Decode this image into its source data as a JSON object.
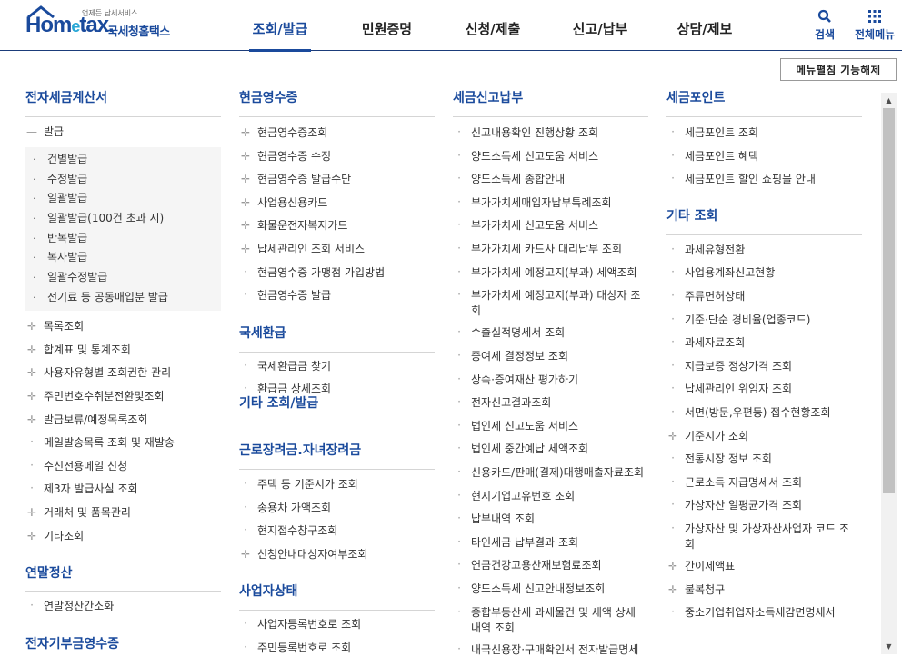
{
  "header": {
    "logo_small": "언제든 납세서비스",
    "logo_main_a": "Hom",
    "logo_main_e": "e",
    "logo_main_b": "tax.",
    "logo_kr": "국세청홈택스",
    "nav": [
      {
        "label": "조회/발급",
        "active": true
      },
      {
        "label": "민원증명",
        "active": false
      },
      {
        "label": "신청/제출",
        "active": false
      },
      {
        "label": "신고/납부",
        "active": false
      },
      {
        "label": "상담/제보",
        "active": false
      }
    ],
    "search_label": "검색",
    "menu_label": "전체메뉴"
  },
  "collapse_button": "메뉴펼침 기능해제",
  "col1": {
    "s1_title": "전자세금계산서",
    "issue_label": "발급",
    "issue_sub": [
      "건별발급",
      "수정발급",
      "일괄발급",
      "일괄발급(100건 초과 시)",
      "반복발급",
      "복사발급",
      "일괄수정발급",
      "전기료 등 공동매입분 발급"
    ],
    "s1_items": [
      "목록조회",
      "합계표 및 통계조회",
      "사용자유형별 조회권한 관리",
      "주민번호수취분전환및조회",
      "발급보류/예정목록조회",
      "메일발송목록 조회 및 재발송",
      "수신전용메일 신청",
      "제3자 발급사실 조회",
      "거래처 및 품목관리",
      "기타조회"
    ],
    "s2_title": "연말정산",
    "s2_items": [
      "연말정산간소화"
    ],
    "s3_title": "전자기부금영수증"
  },
  "col2": {
    "s1_title": "현금영수증",
    "s1_items": [
      "현금영수증조회",
      "현금영수증 수정",
      "현금영수증 발급수단",
      "사업용신용카드",
      "화물운전자복지카드",
      "납세관리인 조회 서비스",
      "현금영수증 가맹점 가입방법",
      "현금영수증 발급"
    ],
    "s2_title": "국세환급",
    "s2_items": [
      "국세환급금 찾기",
      "환급금 상세조회"
    ],
    "s3_title": "기타 조회/발급",
    "s4_title": "근로장려금.자녀장려금",
    "s4_items": [
      "주택 등 기준시가 조회",
      "송용차 가액조회",
      "현지접수창구조회",
      "신청안내대상자여부조회"
    ],
    "s5_title": "사업자상태",
    "s5_items": [
      "사업자등록번호로 조회",
      "주민등록번호로 조회"
    ]
  },
  "col3": {
    "s1_title": "세금신고납부",
    "s1_items": [
      "신고내용확인 진행상황 조회",
      "양도소득세 신고도움 서비스",
      "양도소득세 종합안내",
      "부가가치세매입자납부특례조회",
      "부가가치세 신고도움 서비스",
      "부가가치세 카드사 대리납부 조회",
      "부가가치세 예정고지(부과) 세액조회",
      "부가가치세 예정고지(부과) 대상자 조회",
      "수출실적명세서 조회",
      "증여세 결정정보 조회",
      "상속·증여재산 평가하기",
      "전자신고결과조회",
      "법인세 신고도움 서비스",
      "법인세 중간예납 세액조회",
      "신용카드/판매(결제)대행매출자료조회",
      "현지기업고유번호 조회",
      "납부내역 조회",
      "타인세금 납부결과 조회",
      "연금건강고용산재보험료조회",
      "양도소득세 신고안내정보조회",
      "종합부동산세 과세물건 및 세액 상세내역 조회",
      "내국신용장·구매확인서 전자발급명세"
    ]
  },
  "col4": {
    "s1_title": "세금포인트",
    "s1_items": [
      "세금포인트 조회",
      "세금포인트 혜택",
      "세금포인트 할인 쇼핑몰 안내"
    ],
    "s2_title": "기타 조회",
    "s2_items": [
      "과세유형전환",
      "사업용계좌신고현황",
      "주류면허상태",
      "기준·단순 경비율(업종코드)",
      "과세자료조회",
      "지급보증 정상가격 조회",
      "납세관리인 위임자 조회",
      "서면(방문,우편등) 접수현황조회",
      "기준시가 조회",
      "전통시장 정보 조회",
      "근로소득 지급명세서 조회",
      "가상자산 일평균가격 조회",
      "가상자산 및 가상자산사업자 코드 조회",
      "간이세액표",
      "불복청구",
      "중소기업취업자소득세감면명세서"
    ]
  }
}
